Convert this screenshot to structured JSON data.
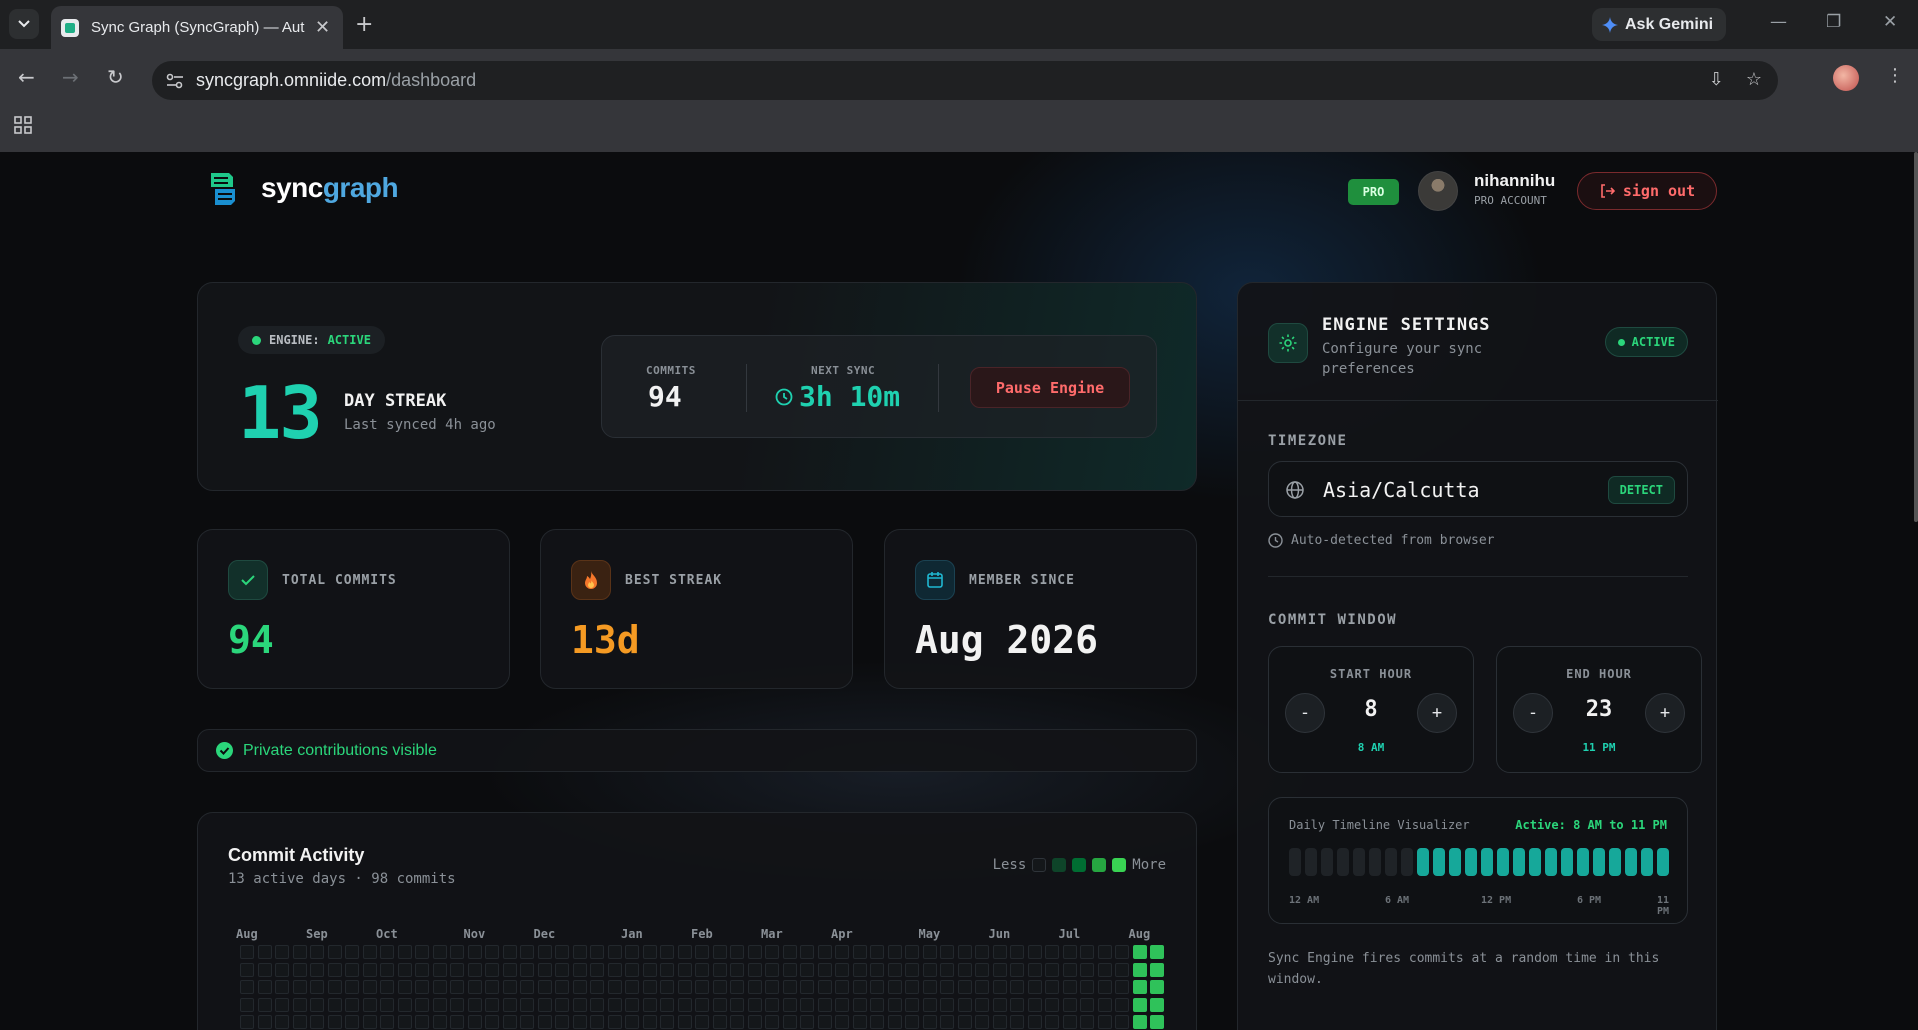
{
  "browser": {
    "tab_title": "Sync Graph (SyncGraph) — Automated Commits",
    "gemini_label": "Ask Gemini",
    "url_host": "syncgraph.omniide.com",
    "url_path": "/dashboard"
  },
  "header": {
    "logo_part1": "sync",
    "logo_part2": "graph",
    "plan_badge": "PRO",
    "username": "nihannihu",
    "account_type": "PRO ACCOUNT",
    "signout_label": "sign out"
  },
  "engine": {
    "status_prefix": "ENGINE:",
    "status_value": "ACTIVE",
    "streak_value": "13",
    "streak_label": "DAY STREAK",
    "last_synced": "Last synced 4h ago",
    "commits_label": "COMMITS",
    "commits_value": "94",
    "next_sync_label": "NEXT SYNC",
    "next_sync_value": "3h 10m",
    "pause_label": "Pause Engine"
  },
  "stats": [
    {
      "label": "TOTAL COMMITS",
      "value": "94",
      "icon": "check-icon",
      "color": "#2bd67b"
    },
    {
      "label": "BEST STREAK",
      "value": "13d",
      "icon": "flame-icon",
      "color": "#f59a23"
    },
    {
      "label": "MEMBER SINCE",
      "value": "Aug 2026",
      "icon": "calendar-icon",
      "color": "#f2f2f2"
    }
  ],
  "private_note": "Private contributions visible",
  "activity": {
    "title": "Commit Activity",
    "subtitle": "13 active days · 98 commits",
    "legend_less": "Less",
    "legend_more": "More",
    "legend_colors": [
      "#14171a",
      "#0e4429",
      "#006d32",
      "#26a641",
      "#39d353"
    ],
    "months": [
      "Aug",
      "Sep",
      "Oct",
      "Nov",
      "Dec",
      "Jan",
      "Feb",
      "Mar",
      "Apr",
      "May",
      "Jun",
      "Jul",
      "Aug"
    ]
  },
  "settings": {
    "title": "ENGINE SETTINGS",
    "subtitle": "Configure your sync preferences",
    "status": "ACTIVE",
    "timezone_label": "TIMEZONE",
    "timezone_value": "Asia/Calcutta",
    "detect_label": "DETECT",
    "timezone_note": "Auto-detected from browser",
    "commit_window_label": "COMMIT WINDOW",
    "start_label": "START HOUR",
    "start_value": "8",
    "start_sub": "8 AM",
    "end_label": "END HOUR",
    "end_value": "23",
    "end_sub": "11 PM",
    "minus": "-",
    "plus": "+",
    "timeline_label": "Daily Timeline Visualizer",
    "timeline_active": "Active: 8 AM to 11 PM",
    "timeline_ticks": [
      "12 AM",
      "6 AM",
      "12 PM",
      "6 PM",
      "11 PM"
    ],
    "fires_note": "Sync Engine fires commits at a random time in this window."
  }
}
